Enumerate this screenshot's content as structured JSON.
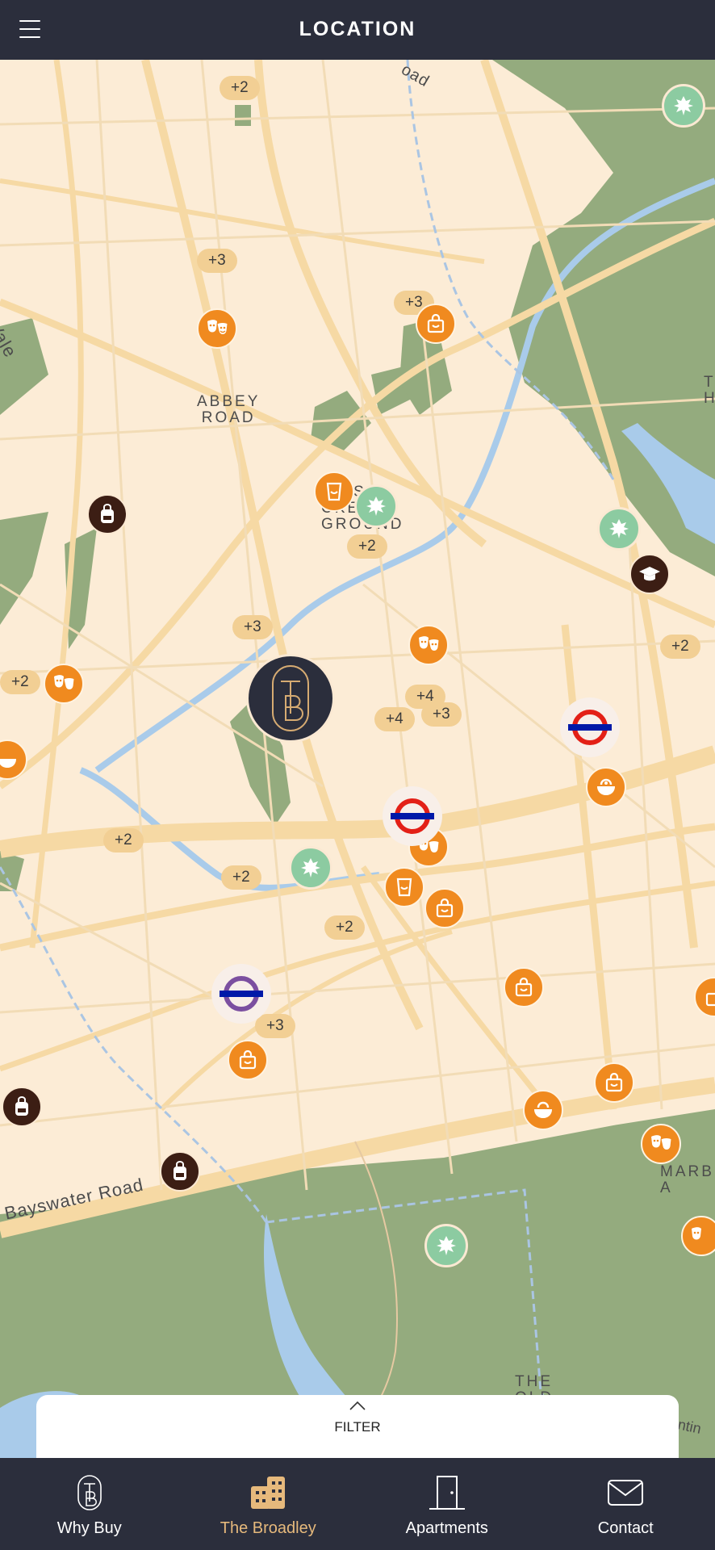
{
  "header": {
    "title": "LOCATION",
    "menu_icon": "hamburger-icon"
  },
  "map": {
    "labels": {
      "abbey_road": "ABBEY\nROAD",
      "lords": "RD'S\nCKET\nGROUND",
      "bayswater": "Bayswater Road",
      "vale": "Vale",
      "road": "oad",
      "marble": "MARB\nA",
      "the_old": "THE\nOLD",
      "th": "T\nH",
      "entin": "entin"
    },
    "clusters": [
      "+2",
      "+3",
      "+3",
      "+2",
      "+3",
      "+2",
      "+2",
      "+4",
      "+4",
      "+3",
      "+2",
      "+2",
      "+2",
      "+3"
    ],
    "marker_types": [
      "theatre-icon",
      "shopping-bag-icon",
      "park-leaf-icon",
      "pint-glass-icon",
      "school-bag-icon",
      "graduation-cap-icon",
      "food-bowl-icon",
      "underground-roundel-icon",
      "elizabeth-line-roundel-icon"
    ],
    "colors": {
      "orange": "#f08a1f",
      "green": "#8ccba1",
      "dark": "#3c1e14",
      "road": "#f6d9a4",
      "park": "#94ab7e",
      "water": "#a9cbea",
      "tube_red": "#e32017",
      "tube_blue": "#0019a8",
      "purple": "#7b4fa0"
    }
  },
  "filter": {
    "label": "FILTER"
  },
  "tabs": [
    {
      "label": "Why Buy",
      "icon": "tb-logo-icon"
    },
    {
      "label": "The Broadley",
      "icon": "buildings-icon",
      "active": true
    },
    {
      "label": "Apartments",
      "icon": "door-icon"
    },
    {
      "label": "Contact",
      "icon": "envelope-icon"
    }
  ]
}
